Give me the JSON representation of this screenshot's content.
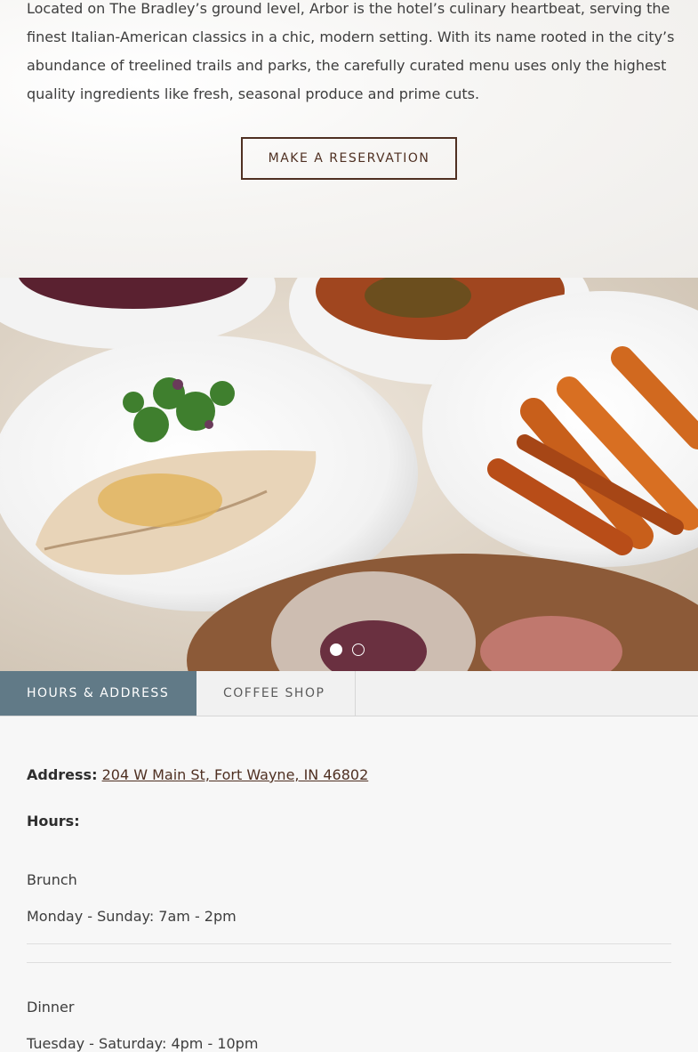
{
  "intro": {
    "text": "Located on The Bradley’s ground level, Arbor is the hotel’s culinary heartbeat, serving the finest Italian-American classics in a chic, modern setting. With its name rooted in the city’s abundance of treelined trails and parks, the carefully curated menu uses only the highest quality ingredients like fresh, seasonal produce and prime cuts.",
    "reserve_label": "MAKE A RESERVATION"
  },
  "carousel": {
    "slide_count": 2,
    "active_slide": 1
  },
  "tabs": [
    {
      "label": "HOURS & ADDRESS",
      "active": true
    },
    {
      "label": "COFFEE SHOP",
      "active": false
    }
  ],
  "info": {
    "address_label": "Address:",
    "address_value": "204 W Main St, Fort Wayne, IN 46802",
    "hours_label": "Hours:",
    "meals": [
      {
        "name": "Brunch",
        "hours": "Monday - Sunday: 7am - 2pm"
      },
      {
        "name": "Dinner",
        "hours": "Tuesday - Saturday: 4pm - 10pm"
      }
    ]
  },
  "colors": {
    "accent_brown": "#4f3022",
    "tab_active_bg": "#617a87",
    "page_bg": "#f7f7f7"
  }
}
